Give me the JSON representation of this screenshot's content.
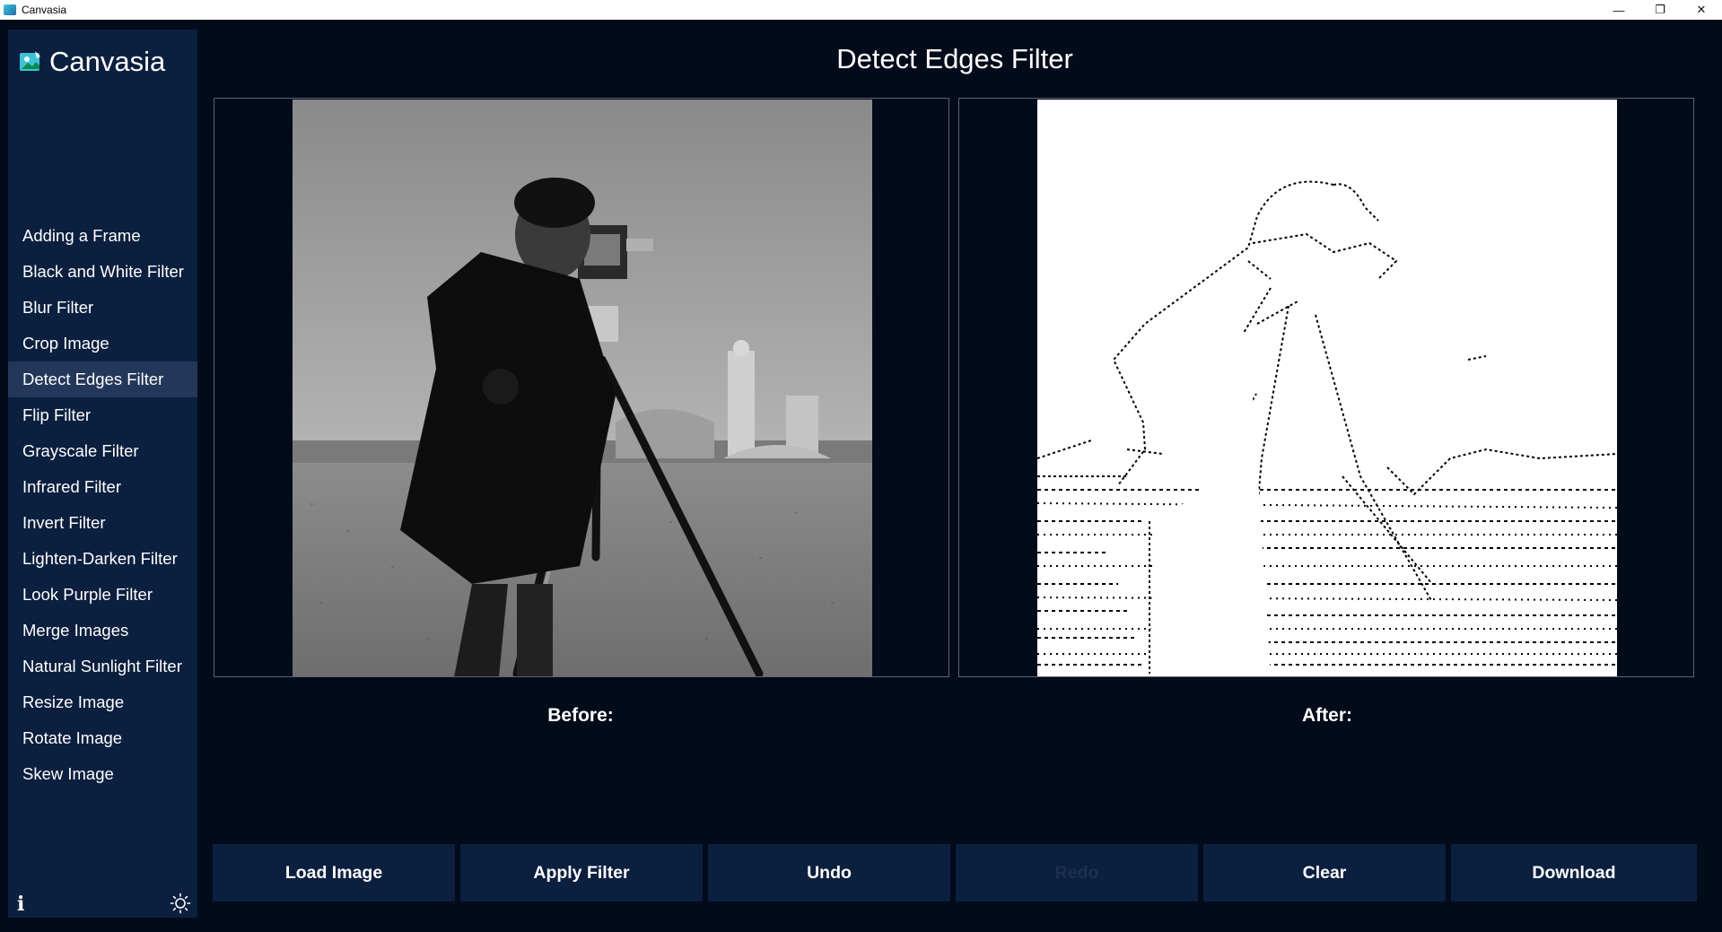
{
  "window": {
    "title": "Canvasia",
    "minimize": "—",
    "restore": "❐",
    "close": "✕"
  },
  "sidebar": {
    "logo_text": "Canvasia",
    "items": [
      {
        "label": "Adding a Frame"
      },
      {
        "label": "Black and White Filter"
      },
      {
        "label": "Blur Filter"
      },
      {
        "label": "Crop Image"
      },
      {
        "label": "Detect Edges Filter",
        "active": true
      },
      {
        "label": "Flip Filter"
      },
      {
        "label": "Grayscale Filter"
      },
      {
        "label": "Infrared Filter"
      },
      {
        "label": "Invert Filter"
      },
      {
        "label": "Lighten-Darken Filter"
      },
      {
        "label": "Look Purple Filter"
      },
      {
        "label": "Merge Images"
      },
      {
        "label": "Natural Sunlight Filter"
      },
      {
        "label": "Resize Image"
      },
      {
        "label": "Rotate Image"
      },
      {
        "label": "Skew Image"
      }
    ],
    "info_icon": "info-icon",
    "theme_icon": "sun-icon"
  },
  "main": {
    "title": "Detect Edges Filter",
    "before_label": "Before:",
    "after_label": "After:"
  },
  "toolbar": {
    "load": "Load Image",
    "apply": "Apply Filter",
    "undo": "Undo",
    "redo": "Redo",
    "redo_disabled": true,
    "clear": "Clear",
    "download": "Download"
  },
  "colors": {
    "background": "#020b1a",
    "sidebar": "#0b1f3f",
    "active_item": "#23375a",
    "button": "#0b1f3f"
  }
}
